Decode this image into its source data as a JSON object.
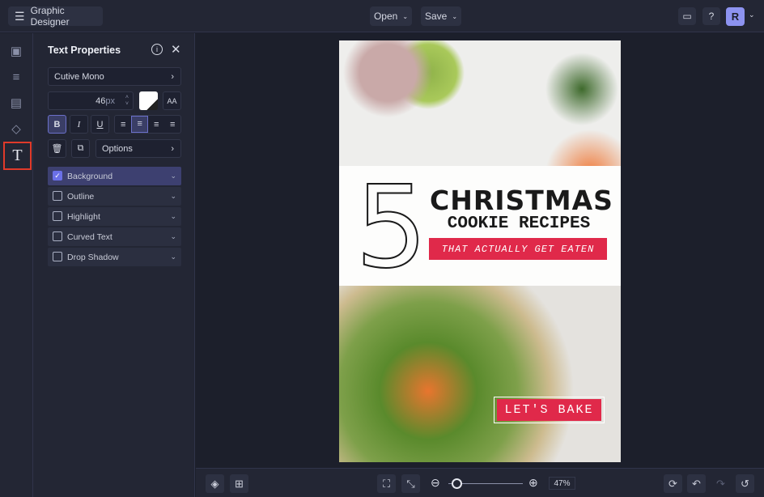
{
  "topbar": {
    "app_title": "Graphic Designer",
    "open_label": "Open",
    "save_label": "Save",
    "avatar_initial": "R"
  },
  "panel": {
    "title": "Text Properties",
    "font": "Cutive Mono",
    "font_size": "46",
    "font_unit": "px",
    "options_label": "Options",
    "effects": [
      {
        "label": "Background",
        "checked": true
      },
      {
        "label": "Outline",
        "checked": false
      },
      {
        "label": "Highlight",
        "checked": false
      },
      {
        "label": "Curved Text",
        "checked": false
      },
      {
        "label": "Drop Shadow",
        "checked": false
      }
    ]
  },
  "poster": {
    "number": "5",
    "title": "CHRISTMAS",
    "subtitle": "COOKIE RECIPES",
    "tagline": "THAT ACTUALLY GET EATEN",
    "button_text": "LET'S BAKE"
  },
  "bottombar": {
    "zoom": "47%",
    "zoom_value": 47
  },
  "colors": {
    "accent": "#5b5fc7",
    "brand_red": "#e0294a"
  }
}
